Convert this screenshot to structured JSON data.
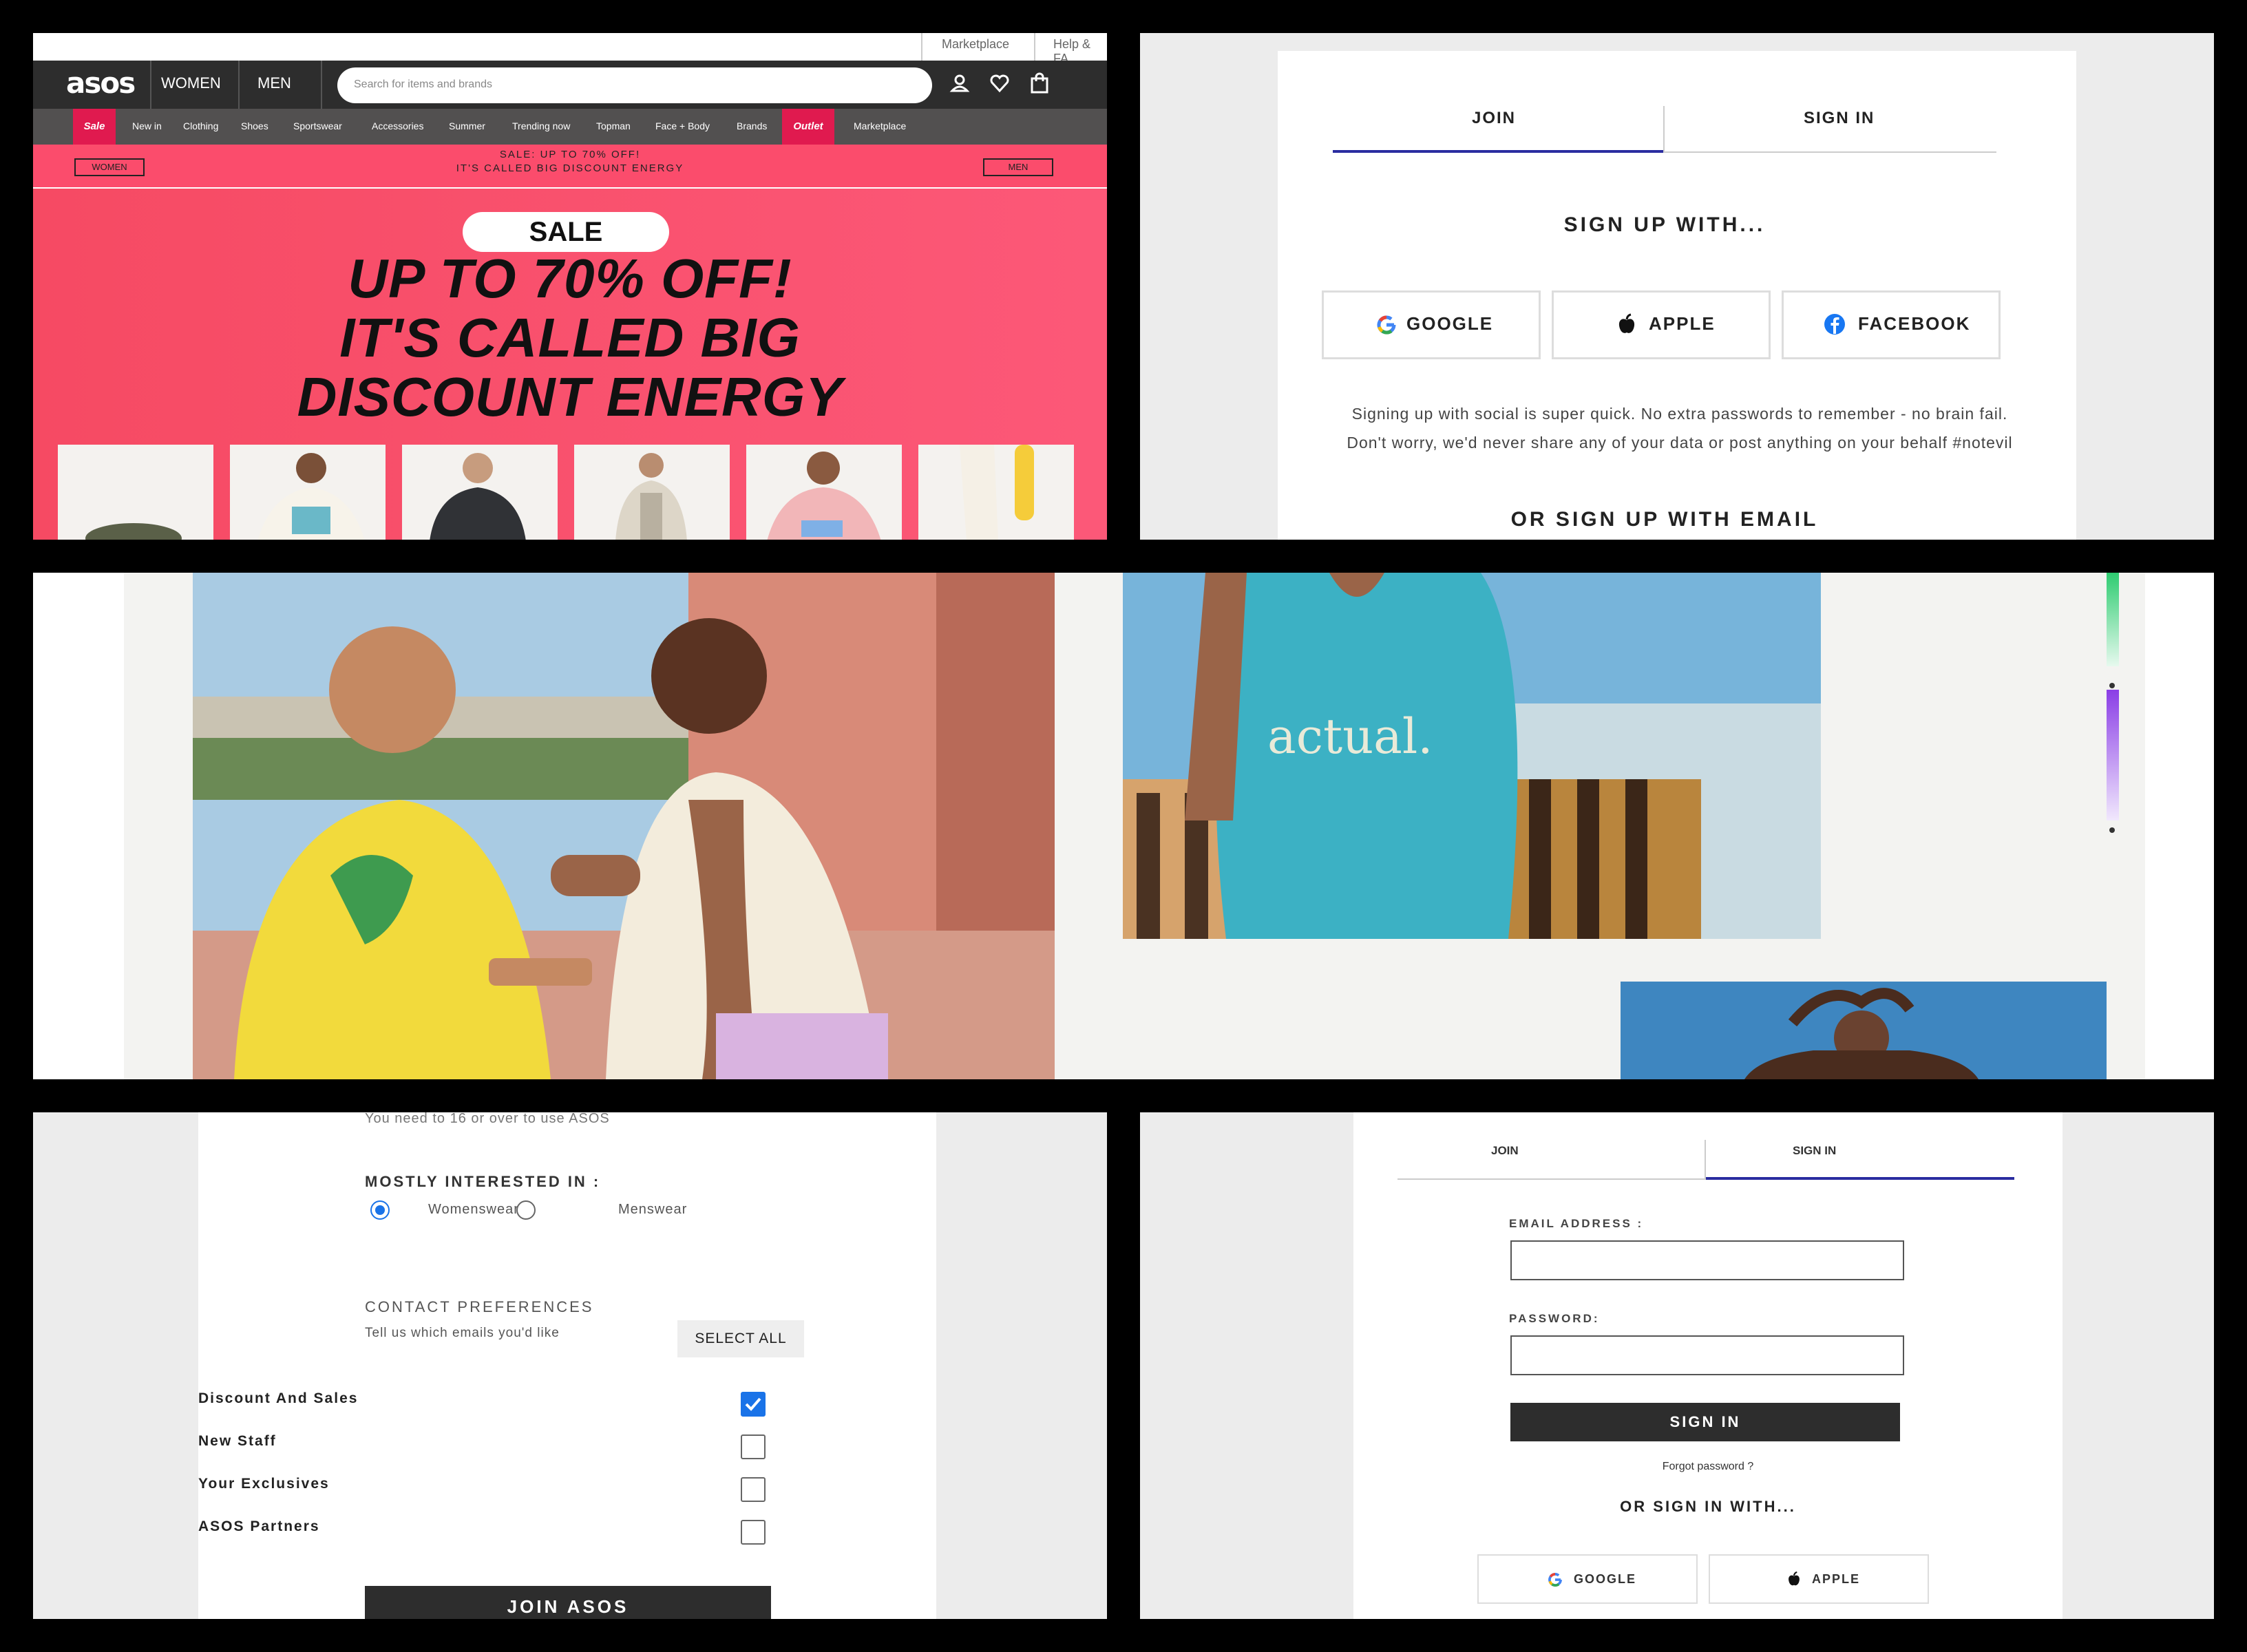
{
  "panel1": {
    "utility_links": [
      "Marketplace",
      "Help & FA"
    ],
    "logo": "asos",
    "gender_tabs": [
      "WOMEN",
      "MEN"
    ],
    "search_placeholder": "Search for items and brands",
    "categories": [
      "Sale",
      "New in",
      "Clothing",
      "Shoes",
      "Sportswear",
      "Accessories",
      "Summer",
      "Trending now",
      "Topman",
      "Face + Body",
      "Brands",
      "Outlet",
      "Marketplace"
    ],
    "promo_line1": "SALE: UP TO 70% OFF!",
    "promo_line2": "IT'S CALLED BIG DISCOUNT ENERGY",
    "promo_women": "WOMEN",
    "promo_men": "MEN",
    "hero_pill": "SALE",
    "hero_lines": [
      "UP TO 70% OFF!",
      "IT'S CALLED BIG",
      "DISCOUNT ENERGY"
    ],
    "accent_color": "#e01a4f"
  },
  "panel2": {
    "tabs": [
      "JOIN",
      "SIGN IN"
    ],
    "heading": "SIGN UP WITH...",
    "social": [
      "GOOGLE",
      "APPLE",
      "FACEBOOK"
    ],
    "note_line1": "Signing up with social is super quick. No extra passwords to remember - no brain fail.",
    "note_line2": "Don't worry, we'd never share any of your data or post anything on your behalf #notevil",
    "email_heading": "OR SIGN UP WITH EMAIL"
  },
  "panel3": {
    "tshirt_print": "actual."
  },
  "panel4": {
    "age_note": "You need to 16 or over to use ASOS",
    "interest_label": "MOSTLY INTERESTED IN :",
    "interest_options": [
      "Womenswear",
      "Menswear"
    ],
    "interest_selected": "Womenswear",
    "contact_label": "CONTACT PREFERENCES",
    "contact_sub": "Tell us which emails you'd like",
    "select_all": "SELECT ALL",
    "prefs": [
      "Discount And Sales",
      "New Staff",
      "Your Exclusives",
      "ASOS Partners"
    ],
    "prefs_checked": [
      true,
      false,
      false,
      false
    ],
    "join_button": "JOIN ASOS"
  },
  "panel5": {
    "tabs": [
      "JOIN",
      "SIGN IN"
    ],
    "email_label": "EMAIL ADDRESS :",
    "password_label": "PASSWORD:",
    "sign_in_button": "SIGN IN",
    "forgot": "Forgot password ?",
    "or_with": "OR SIGN IN WITH...",
    "social": [
      "GOOGLE",
      "APPLE"
    ]
  }
}
